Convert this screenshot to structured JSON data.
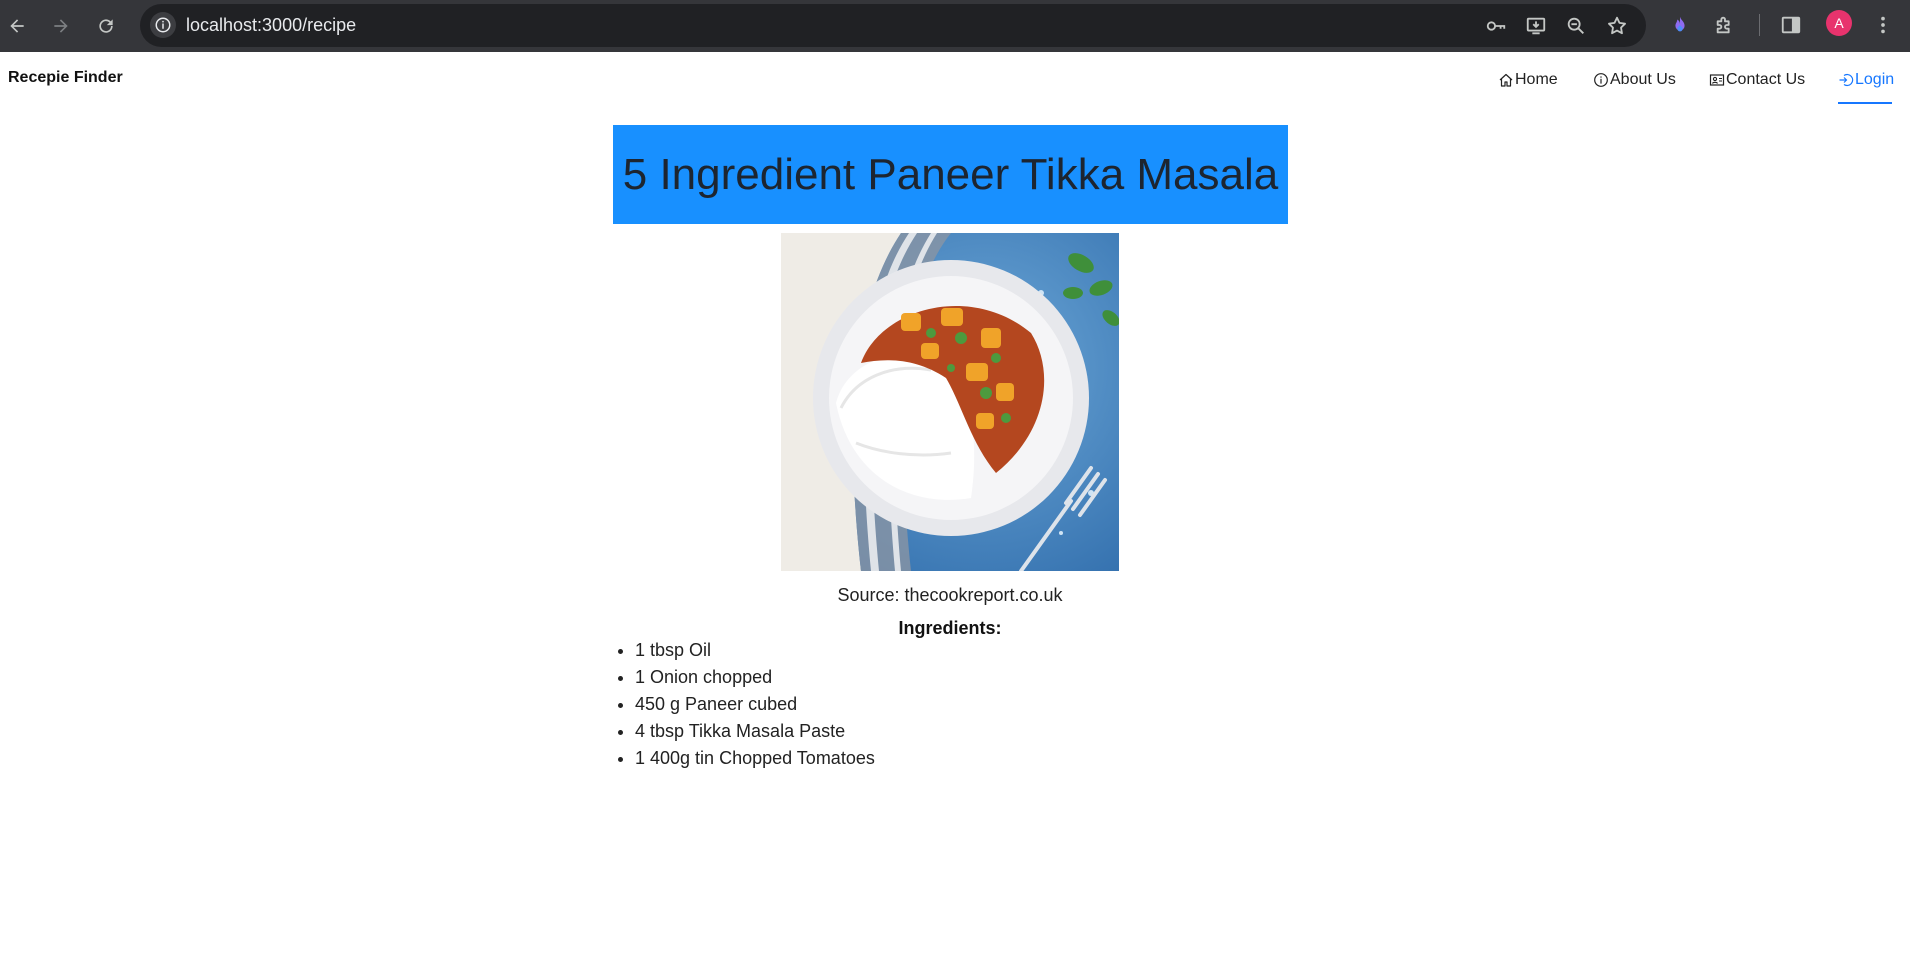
{
  "browser": {
    "url": "localhost:3000/recipe",
    "profile_initial": "A",
    "icons": [
      "back-icon",
      "forward-icon",
      "reload-icon",
      "site-info-icon",
      "key-icon",
      "install-app-icon",
      "zoom-icon",
      "star-icon",
      "extension-flame-icon",
      "extensions-puzzle-icon",
      "side-panel-icon",
      "menu-dots-icon"
    ]
  },
  "navbar": {
    "brand": "Recepie Finder",
    "items": [
      {
        "label": "Home",
        "icon": "home-icon"
      },
      {
        "label": "About Us",
        "icon": "info-icon"
      },
      {
        "label": "Contact Us",
        "icon": "contact-card-icon"
      },
      {
        "label": "Login",
        "icon": "login-icon",
        "active": true
      }
    ],
    "accent": "#1677ff"
  },
  "recipe": {
    "title": "5 Ingredient Paneer Tikka Masala",
    "title_bg": "#1890ff",
    "image_alt": "bowl of paneer tikka masala with white rice",
    "source": "Source: thecookreport.co.uk",
    "ingredients_heading": "Ingredients:",
    "ingredients": [
      "1 tbsp Oil",
      "1 Onion chopped",
      "450 g Paneer cubed",
      "4 tbsp Tikka Masala Paste",
      "1 400g tin Chopped Tomatoes"
    ]
  }
}
